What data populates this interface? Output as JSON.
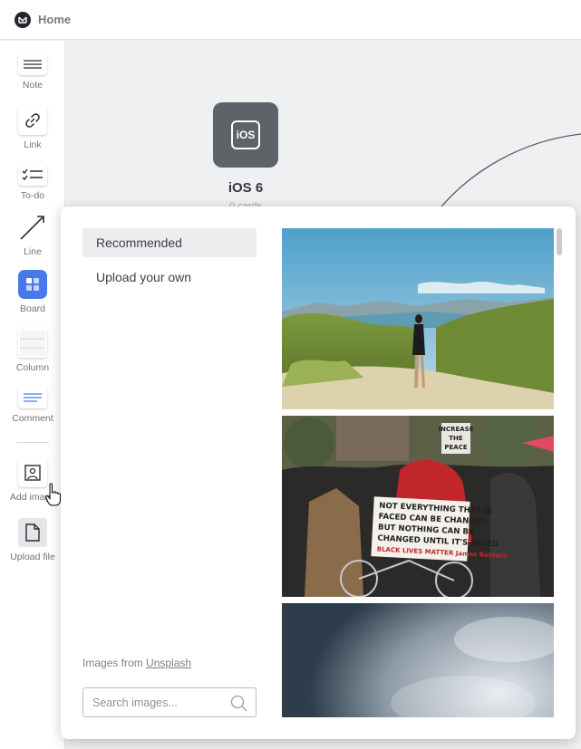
{
  "header": {
    "breadcrumb": "Home"
  },
  "toolbar": {
    "items": [
      {
        "label": "Note",
        "icon": "note-icon"
      },
      {
        "label": "Link",
        "icon": "link-icon"
      },
      {
        "label": "To-do",
        "icon": "todo-icon"
      },
      {
        "label": "Line",
        "icon": "line-icon"
      },
      {
        "label": "Board",
        "icon": "board-icon"
      },
      {
        "label": "Column",
        "icon": "column-icon"
      },
      {
        "label": "Comment",
        "icon": "comment-icon"
      },
      {
        "label": "Add image",
        "icon": "image-icon"
      },
      {
        "label": "Upload file",
        "icon": "file-icon"
      }
    ]
  },
  "canvas": {
    "board": {
      "icon_text": "iOS",
      "title": "iOS 6",
      "subtitle": "0 cards"
    }
  },
  "image_panel": {
    "menu": [
      {
        "label": "Recommended",
        "active": true
      },
      {
        "label": "Upload your own",
        "active": false
      }
    ],
    "credit_prefix": "Images from",
    "credit_link": "Unsplash",
    "search_placeholder": "Search images...",
    "photo_signs": {
      "sign1": [
        "NOT EVERYTHING THAT IS",
        "FACED CAN BE CHANGED",
        "BUT NOTHING CAN BE",
        "CHANGED UNTIL IT'S FACED",
        "BLACK LIVES MATTER James Baldwin"
      ],
      "sign2": [
        "INCREASE",
        "THE",
        "PEACE"
      ]
    }
  },
  "colors": {
    "accent": "#4a78e8",
    "board_icon": "#5e6369"
  }
}
